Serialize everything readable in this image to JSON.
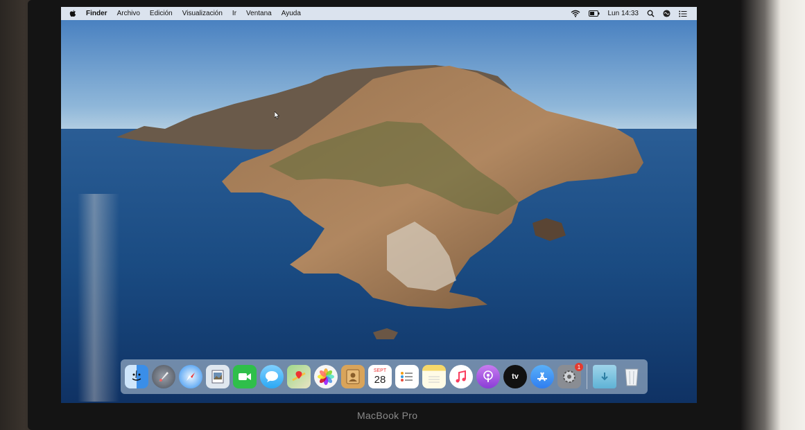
{
  "menubar": {
    "app_name": "Finder",
    "menus": [
      "Archivo",
      "Edición",
      "Visualización",
      "Ir",
      "Ventana",
      "Ayuda"
    ],
    "clock": "Lun 14:33",
    "status_icons": [
      "wifi-icon",
      "battery-icon",
      "spotlight-icon",
      "siri-icon",
      "notification-center-icon"
    ]
  },
  "dock": {
    "apps": [
      {
        "name": "Finder",
        "icon": "finder-icon",
        "color": "#3a8ee8"
      },
      {
        "name": "Launchpad",
        "icon": "launchpad-icon",
        "color": "#6c7380"
      },
      {
        "name": "Safari",
        "icon": "safari-icon",
        "color": "#2e8ef0"
      },
      {
        "name": "Preview",
        "icon": "preview-icon",
        "color": "#8aa9c9"
      },
      {
        "name": "FaceTime",
        "icon": "facetime-icon",
        "color": "#2fbf4a"
      },
      {
        "name": "Messages",
        "icon": "messages-icon",
        "color": "#2aa8f5"
      },
      {
        "name": "Maps",
        "icon": "maps-icon",
        "color": "#7cc46a"
      },
      {
        "name": "Photos",
        "icon": "photos-icon",
        "color": "#f2f2f2"
      },
      {
        "name": "Contacts",
        "icon": "contacts-icon",
        "color": "#d9a45a"
      },
      {
        "name": "Calendar",
        "icon": "calendar-icon",
        "color": "#ffffff",
        "month": "SEPT",
        "day": "28"
      },
      {
        "name": "Reminders",
        "icon": "reminders-icon",
        "color": "#ffffff"
      },
      {
        "name": "Notes",
        "icon": "notes-icon",
        "color": "#f6d86a"
      },
      {
        "name": "Music",
        "icon": "music-icon",
        "color": "#ffffff"
      },
      {
        "name": "Podcasts",
        "icon": "podcasts-icon",
        "color": "#9b4fd6"
      },
      {
        "name": "TV",
        "icon": "tv-icon",
        "color": "#111111",
        "label": "tv"
      },
      {
        "name": "App Store",
        "icon": "app-store-icon",
        "color": "#2f8cf1"
      },
      {
        "name": "System Preferences",
        "icon": "system-preferences-icon",
        "color": "#8a8d93",
        "badge": "1"
      }
    ],
    "trailing": [
      {
        "name": "Downloads",
        "icon": "downloads-folder-icon",
        "color": "#7ac4e0"
      },
      {
        "name": "Trash",
        "icon": "trash-icon",
        "color": "#e4e8ec"
      }
    ]
  },
  "device": {
    "brand": "MacBook Pro"
  },
  "colors": {
    "sea": "#1a4a7f",
    "sky": "#6d9fcf",
    "island": "#8a6a45",
    "menubar": "#e8ecf2"
  }
}
